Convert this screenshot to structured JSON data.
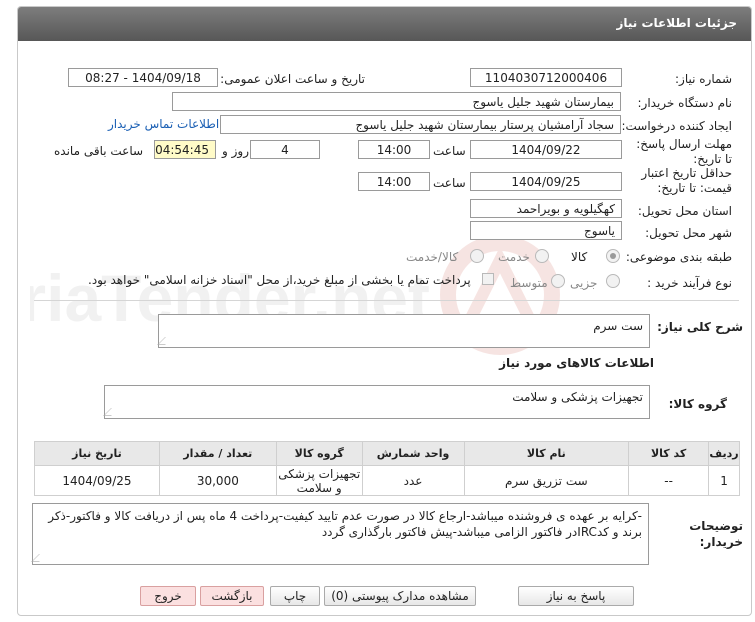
{
  "header": {
    "title": "جزئیات اطلاعات نیاز"
  },
  "fields": {
    "need_number_label": "شماره نیاز:",
    "need_number": "1104030712000406",
    "announce_label": "تاریخ و ساعت اعلان عمومی:",
    "announce_value": "1404/09/18 - 08:27",
    "buyer_org_label": "نام دستگاه خریدار:",
    "buyer_org": "بیمارستان شهید جلیل یاسوج",
    "creator_label": "ایجاد کننده درخواست:",
    "creator": "سجاد آرامشیان پرستار بیمارستان شهید جلیل یاسوج",
    "contact_link": "اطلاعات تماس خریدار",
    "reply_deadline_label": "مهلت ارسال پاسخ: تا تاریخ:",
    "reply_date": "1404/09/22",
    "time_label": "ساعت",
    "reply_time": "14:00",
    "days_value": "4",
    "days_label": "روز و",
    "remaining_time": "04:54:45",
    "remaining_label": "ساعت باقی مانده",
    "validity_label": "حداقل تاریخ اعتبار قیمت: تا تاریخ:",
    "validity_date": "1404/09/25",
    "validity_time": "14:00",
    "province_label": "استان محل تحویل:",
    "province": "کهگیلویه و بویراحمد",
    "city_label": "شهر محل تحویل:",
    "city": "یاسوج",
    "category_label": "طبقه بندی موضوعی:",
    "category_options": [
      "کالا",
      "خدمت",
      "کالا/خدمت"
    ],
    "purchase_type_label": "نوع فرآیند خرید :",
    "purchase_options": [
      "جزیی",
      "متوسط"
    ],
    "payment_note": "پرداخت تمام یا بخشی از مبلغ خرید،از محل \"اسناد خزانه اسلامی\" خواهد بود."
  },
  "description": {
    "label": "شرح کلی نیاز:",
    "value": "ست سرم"
  },
  "goods_section_title": "اطلاعات کالاهای مورد نیاز",
  "goods_group": {
    "label": "گروه کالا:",
    "value": "تجهیزات پزشکی و سلامت"
  },
  "table": {
    "headers": [
      "ردیف",
      "کد کالا",
      "نام کالا",
      "واحد شمارش",
      "گروه کالا",
      "تعداد / مقدار",
      "تاریخ نیاز"
    ],
    "rows": [
      [
        "1",
        "--",
        "ست تزریق سرم",
        "عدد",
        "تجهیزات پزشکی و سلامت",
        "30,000",
        "1404/09/25"
      ]
    ]
  },
  "buyer_notes": {
    "label": "توضیحات خریدار:",
    "value": "-کرایه بر عهده ی فروشنده میباشد-ارجاع کالا در صورت عدم تایید کیفیت-پرداخت 4 ماه پس از دریافت کالا و فاکتور-ذکر برند و کدIRCدر فاکتور الزامی میباشد-پیش فاکتور بارگذاری گردد"
  },
  "buttons": {
    "reply": "پاسخ به نیاز",
    "attachments": "مشاهده مدارک پیوستی (0)",
    "print": "چاپ",
    "back": "بازگشت",
    "exit": "خروج"
  },
  "watermark": {
    "text": "AriaTender.net"
  }
}
